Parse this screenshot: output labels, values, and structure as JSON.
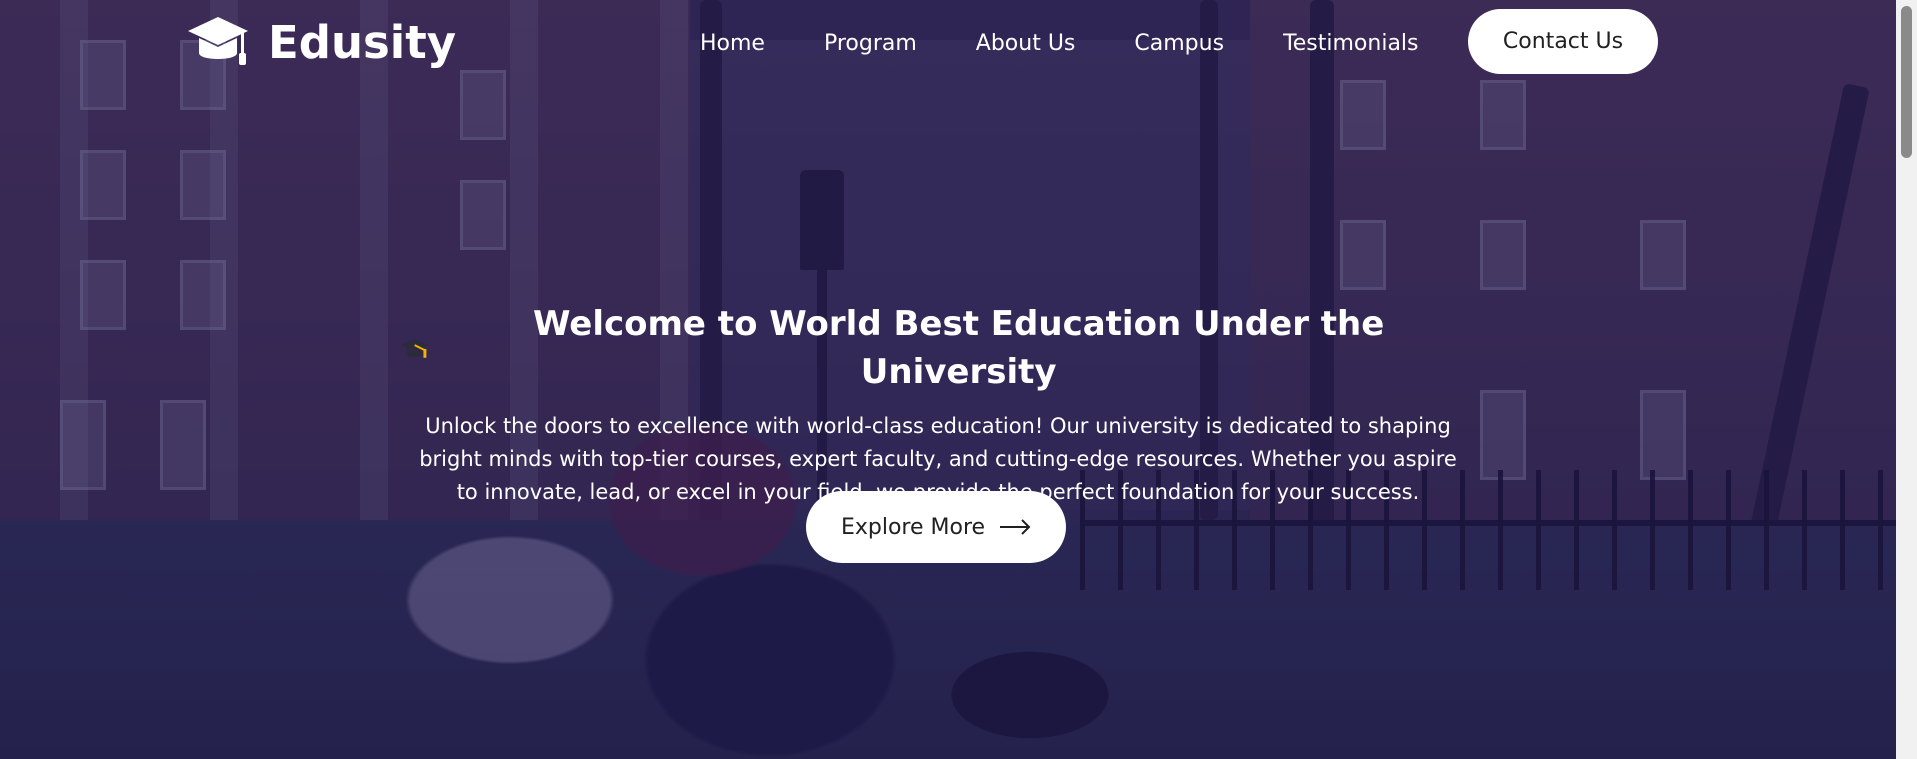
{
  "brand": {
    "name": "Edusity",
    "logo_icon": "graduation-cap-icon"
  },
  "nav": {
    "items": [
      {
        "label": "Home"
      },
      {
        "label": "Program"
      },
      {
        "label": "About Us"
      },
      {
        "label": "Campus"
      },
      {
        "label": "Testimonials"
      }
    ],
    "contact_label": "Contact Us"
  },
  "hero": {
    "title_icon": "graduation-cap-emoji",
    "title": "Welcome to World Best Education Under the University",
    "description": "Unlock the doors to excellence with world-class education! Our university is dedicated to shaping bright minds with top-tier courses, expert faculty, and cutting-edge resources. Whether you aspire to innovate, lead, or excel in your field, we provide the perfect foundation for your success.",
    "cta_label": "Explore More",
    "cta_icon": "arrow-right-icon",
    "overlay_color": "#1e1950"
  },
  "colors": {
    "button_bg": "#ffffff",
    "button_text": "#212121",
    "text": "#ffffff"
  }
}
